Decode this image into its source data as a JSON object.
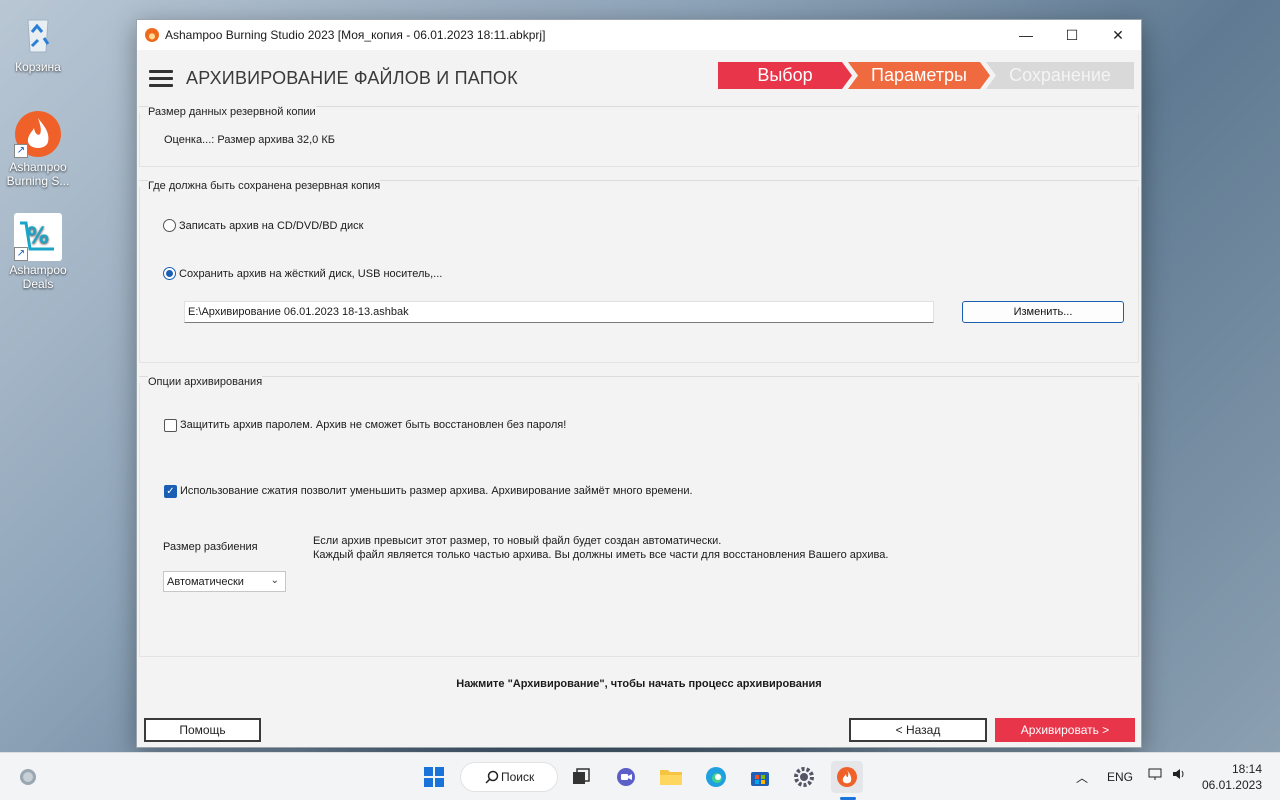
{
  "desktop": {
    "icons": [
      {
        "label": "Корзина",
        "icon": "recycle-bin-icon"
      },
      {
        "label": "Ashampoo\nBurning S...",
        "icon": "flame-icon"
      },
      {
        "label": "Ashampoo\nDeals",
        "icon": "percent-cart-icon"
      }
    ]
  },
  "window": {
    "title": "Ashampoo Burning Studio 2023 [Моя_копия - 06.01.2023 18:11.abkprj]",
    "controls": {
      "minimize": "—",
      "maximize": "☐",
      "close": "✕"
    }
  },
  "header": {
    "title": "АРХИВИРОВАНИЕ ФАЙЛОВ И ПАПОК",
    "steps": [
      "Выбор",
      "Параметры",
      "Сохранение"
    ]
  },
  "size_section": {
    "label": "Размер данных резервной копии",
    "estimate": "Оценка...: Размер архива  32,0 КБ"
  },
  "location_section": {
    "label": "Где должна быть сохранена резервная копия",
    "option_disc": "Записать архив на CD/DVD/BD диск",
    "option_disk": "Сохранить архив на жёсткий диск, USB носитель,...",
    "selected": "option_disk",
    "path_value": "E:\\Архивирование 06.01.2023 18-13.ashbak",
    "change_button": "Изменить..."
  },
  "options_section": {
    "label": "Опции архивирования",
    "password_option": "Защитить архив паролем. Архив не сможет быть восстановлен без пароля!",
    "password_checked": false,
    "compression_option": "Использование сжатия позволит уменьшить размер архива. Архивирование займёт много времени.",
    "compression_checked": true,
    "split_label": "Размер разбиения",
    "split_hint_1": "Если архив превысит этот размер, то новый файл будет создан автоматически.",
    "split_hint_2": "Каждый файл является только частью архива. Вы должны иметь все части для восстановления Вашего архива.",
    "split_value": "Автоматически"
  },
  "footer": {
    "hint": "Нажмите \"Архивирование\", чтобы начать процесс архивирования",
    "help_button": "Помощь",
    "back_button": "< Назад",
    "archive_button": "Архивировать >"
  },
  "taskbar": {
    "search_label": "Поиск",
    "language": "ENG",
    "time": "18:14",
    "date": "06.01.2023"
  },
  "colors": {
    "step_active": "#e8354a",
    "step_current": "#f06a3f",
    "step_inactive": "#d9d9d9",
    "accent": "#1a5fb4"
  }
}
